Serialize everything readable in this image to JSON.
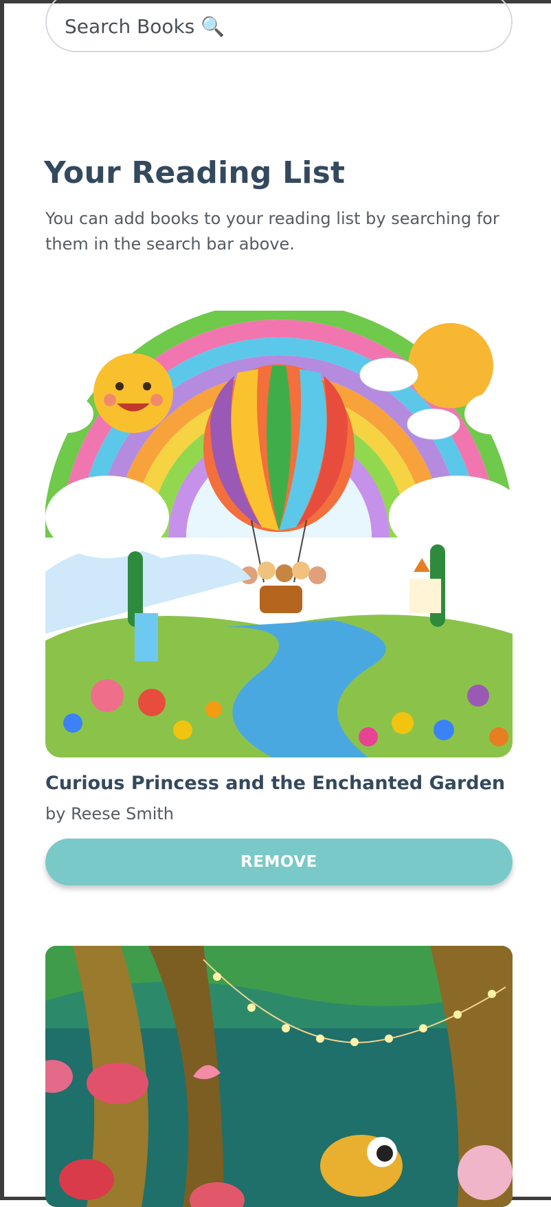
{
  "search": {
    "placeholder": "Search Books 🔍"
  },
  "reading_list": {
    "title": "Your Reading List",
    "intro": "You can add books to your reading list by searching for them in the search bar above."
  },
  "books": [
    {
      "title": "Curious Princess and the Enchanted Garden",
      "author": "by Reese Smith",
      "action_label": "REMOVE",
      "cover_icon": "rainbow-balloon-illustration"
    },
    {
      "cover_icon": "enchanted-forest-illustration"
    }
  ],
  "colors": {
    "heading": "#34495e",
    "body_text": "#555b62",
    "button": "#79c9c9",
    "search_border": "#d5d8dc"
  }
}
